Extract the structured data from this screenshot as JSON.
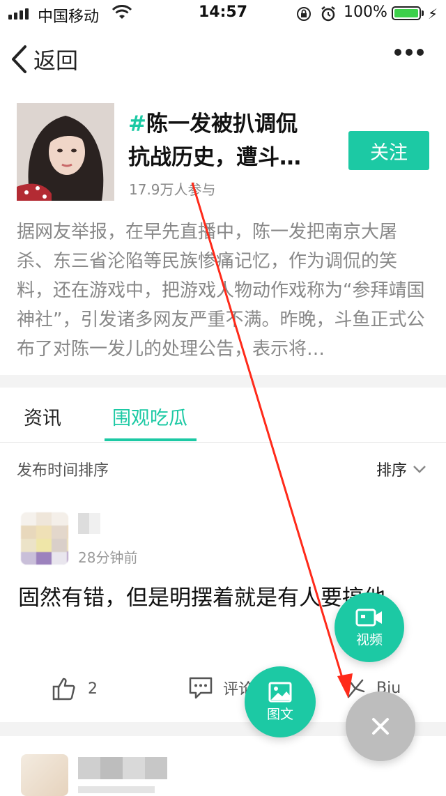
{
  "status_bar": {
    "carrier": "中国移动",
    "time": "14:57",
    "battery": "100%"
  },
  "nav": {
    "back_label": "返回"
  },
  "topic": {
    "hash": "#",
    "title_line1": "陈一发被扒调侃",
    "title_line2": "抗战历史，遭斗…",
    "participants": "17.9万人参与",
    "follow_label": "关注",
    "description": "据网友举报，在早先直播中，陈一发把南京大屠杀、东三省沦陷等民族惨痛记忆，作为调侃的笑料，还在游戏中，把游戏人物动作戏称为“参拜靖国神社”，引发诸多网友严重不满。昨晚，斗鱼正式公布了对陈一发儿的处理公告，表示将…"
  },
  "tabs": [
    {
      "label": "资讯",
      "active": false
    },
    {
      "label": "围观吃瓜",
      "active": true
    }
  ],
  "sort": {
    "caption": "发布时间排序",
    "button_label": "排序"
  },
  "post": {
    "time": "28分钟前",
    "content": "固然有错，但是明摆着就是有人要搞他",
    "like_count": "2",
    "comment_label": "评论",
    "share_label": "Biu"
  },
  "fabs": {
    "video_label": "视频",
    "image_label": "图文"
  },
  "colors": {
    "accent": "#1cc9a4",
    "annotation": "#ff2a1a"
  }
}
